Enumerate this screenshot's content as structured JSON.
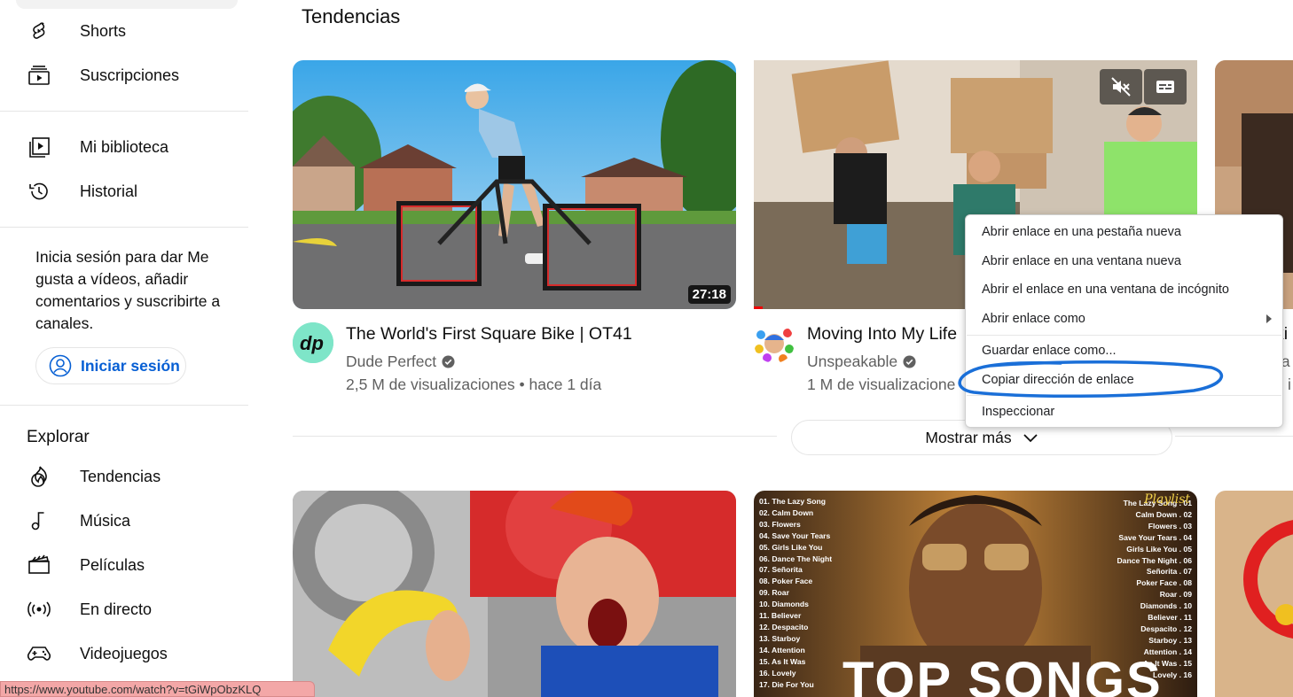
{
  "sidebar": {
    "items_top": [
      {
        "label": "Shorts",
        "icon": "shorts-icon"
      },
      {
        "label": "Suscripciones",
        "icon": "subscriptions-icon"
      }
    ],
    "items_library": [
      {
        "label": "Mi biblioteca",
        "icon": "library-icon"
      },
      {
        "label": "Historial",
        "icon": "history-icon"
      }
    ],
    "signin_prompt": "Inicia sesión para dar Me gusta a vídeos, añadir comentarios y suscribirte a canales.",
    "signin_button": "Iniciar sesión",
    "explore_heading": "Explorar",
    "explore_items": [
      {
        "label": "Tendencias",
        "icon": "trending-icon"
      },
      {
        "label": "Música",
        "icon": "music-icon"
      },
      {
        "label": "Películas",
        "icon": "movies-icon"
      },
      {
        "label": "En directo",
        "icon": "live-icon"
      },
      {
        "label": "Videojuegos",
        "icon": "gaming-icon"
      }
    ]
  },
  "main": {
    "section_title": "Tendencias",
    "videos": [
      {
        "title": "The World's First Square Bike | OT41",
        "channel": "Dude Perfect",
        "verified": true,
        "meta": "2,5 M de visualizaciones • hace 1 día",
        "duration": "27:18"
      },
      {
        "title": "Moving Into My Life",
        "channel": "Unspeakable",
        "verified": true,
        "meta": "1 M de visualizacione"
      }
    ],
    "show_more": "Mostrar más",
    "playlist_thumb": {
      "badge": "Playlist",
      "big_text": "TOP SONGS",
      "tracks_left": [
        "01. The Lazy Song",
        "02. Calm Down",
        "03. Flowers",
        "04. Save Your Tears",
        "05. Girls Like You",
        "06. Dance The Night",
        "07. Señorita",
        "08. Poker Face",
        "09. Roar",
        "10. Diamonds",
        "11. Believer",
        "12. Despacito",
        "13. Starboy",
        "14. Attention",
        "15. As It Was",
        "16. Lovely",
        "17. Die For You"
      ],
      "tracks_right": [
        "The Lazy Song . 01",
        "Calm Down . 02",
        "Flowers . 03",
        "Save Your Tears . 04",
        "Girls Like You . 05",
        "Dance The Night . 06",
        "Señorita . 07",
        "Poker Face . 08",
        "Roar . 09",
        "Diamonds . 10",
        "Believer . 11",
        "Despacito . 12",
        "Starboy . 13",
        "Attention . 14",
        "As It Was . 15",
        "Lovely . 16"
      ]
    }
  },
  "context_menu": {
    "items": [
      "Abrir enlace en una pestaña nueva",
      "Abrir enlace en una ventana nueva",
      "Abrir el enlace en una ventana de incógnito",
      "Abrir enlace como",
      "Guardar enlace como...",
      "Copiar dirección de enlace",
      "Inspeccionar"
    ]
  },
  "statusbar": {
    "url": "https://www.youtube.com/watch?v=tGiWpObzKLQ"
  },
  "colors": {
    "link_blue": "#065fd4",
    "annotation_blue": "#1a6fd8",
    "status_bar_bg": "#f3a7a7"
  }
}
